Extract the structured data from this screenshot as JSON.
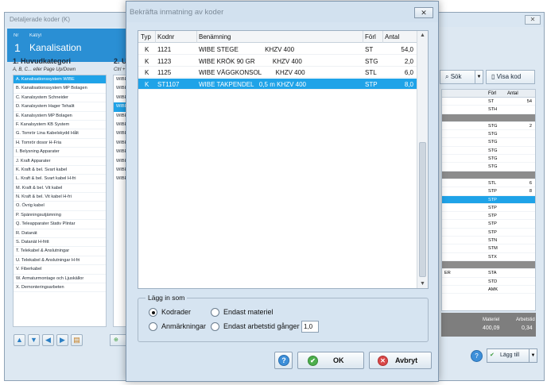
{
  "bg": {
    "title": "Detaljerade koder (K)",
    "close": "✕",
    "header": {
      "nr_label": "Nr",
      "kat_label": "Kat/yl",
      "number": "1",
      "name": "Kanalisation"
    },
    "huvudkategori": {
      "title": "1. Huvudkategori",
      "hint": "A, B, C... eller Page Up/Down",
      "items": [
        "A. Kanalisationssystem WIBE",
        "B. Kanalisationssystem MP Bolagen",
        "C. Kanalsystem Schneider",
        "D. Kanalsystem Hager Tehalit",
        "E. Kanalsystem MP Bolagen",
        "F. Kanalsystem KB System",
        "G. Tomrör Lina Kabelskydd Hålt",
        "H. Tomrör dosor H-Fria",
        "I. Belysning Apparater",
        "J. Kraft Apparater",
        "K. Kraft & bel. Svart kabel",
        "L. Kraft & bel. Svart kabel H-fri",
        "M. Kraft & bel. Vit kabel",
        "N. Kraft & bel. Vit kabel H-fri",
        "O. Övrig kabel",
        "P. Spänningsutjämning",
        "Q. Teleapparater Stativ Plintar",
        "R. Datanät",
        "S. Datanät H-fritt",
        "T. Telekabel & Anslutningar",
        "U. Telekabel & Anslutningar H-fri",
        "V. Fiberkabel",
        "W. Armaturmontage och Ljuskällor",
        "X. Demonteringsarbeten"
      ]
    },
    "underkategori": {
      "title": "2. Ur",
      "hint": "Ctrl + U",
      "items": [
        "WIBE",
        "WIBE",
        "WIBE",
        "WIBE",
        "WIBE",
        "WIBE",
        "WIBE",
        "WIBE",
        "WIBE",
        "WIBE",
        "WIBE",
        "WIBE"
      ]
    },
    "sok_label": "Sök",
    "visa_kod_label": "Visa kod",
    "right_grid": {
      "headers": [
        "Förl",
        "Antal"
      ],
      "rows": [
        {
          "a": "",
          "f": "ST",
          "n": "54"
        },
        {
          "a": "",
          "f": "STH",
          "n": ""
        },
        {
          "a": "",
          "f": "",
          "n": "",
          "grp": true
        },
        {
          "a": "",
          "f": "STG",
          "n": "2"
        },
        {
          "a": "",
          "f": "STG",
          "n": ""
        },
        {
          "a": "",
          "f": "STG",
          "n": ""
        },
        {
          "a": "",
          "f": "STG",
          "n": ""
        },
        {
          "a": "",
          "f": "STG",
          "n": ""
        },
        {
          "a": "",
          "f": "STG",
          "n": ""
        },
        {
          "a": "",
          "f": "",
          "n": "",
          "grp": true
        },
        {
          "a": "",
          "f": "STL",
          "n": "6"
        },
        {
          "a": "",
          "f": "STP",
          "n": "8"
        },
        {
          "a": "",
          "f": "STP",
          "n": "",
          "sel": true
        },
        {
          "a": "",
          "f": "STP",
          "n": ""
        },
        {
          "a": "",
          "f": "STP",
          "n": ""
        },
        {
          "a": "",
          "f": "STP",
          "n": ""
        },
        {
          "a": "",
          "f": "STP",
          "n": ""
        },
        {
          "a": "",
          "f": "STN",
          "n": ""
        },
        {
          "a": "",
          "f": "STM",
          "n": ""
        },
        {
          "a": "",
          "f": "STX",
          "n": ""
        },
        {
          "a": "",
          "f": "",
          "n": "",
          "grp": true
        },
        {
          "a": "ER",
          "f": "STA",
          "n": ""
        },
        {
          "a": "",
          "f": "STD",
          "n": ""
        },
        {
          "a": "",
          "f": "AMK",
          "n": ""
        }
      ]
    },
    "totals": {
      "materiel_label": "Materiel",
      "arbetstid_label": "Arbetstid",
      "materiel_value": "400,09",
      "arbetstid_value": "0,34"
    },
    "lagg_till_label": "Lägg till"
  },
  "dialog": {
    "title": "Bekräfta inmatning av koder",
    "close": "✕",
    "columns": {
      "typ": "Typ",
      "kodnr": "Kodnr",
      "benamning": "Benämning",
      "forl": "Förl",
      "antal": "Antal"
    },
    "rows": [
      {
        "typ": "K",
        "kodnr": "1121",
        "benamning": "WIBE STEGE               KHZV 400",
        "forl": "ST",
        "antal": "54,0",
        "selected": false
      },
      {
        "typ": "K",
        "kodnr": "1123",
        "benamning": "WIBE KRÖK 90 GR          KHZV 400",
        "forl": "STG",
        "antal": "2,0",
        "selected": false
      },
      {
        "typ": "K",
        "kodnr": "1125",
        "benamning": "WIBE VÄGGKONSOL        KHZV 400",
        "forl": "STL",
        "antal": "6,0",
        "selected": false
      },
      {
        "typ": "K",
        "kodnr": "ST1107",
        "benamning": "WIBE TAKPENDEL   0,5 m KHZV 400",
        "forl": "STP",
        "antal": "8,0",
        "selected": true
      }
    ],
    "lagg_in_som": {
      "legend": "Lägg in som",
      "options": {
        "kodrader": "Kodrader",
        "endast_materiel": "Endast materiel",
        "anmarkningar": "Anmärkningar",
        "endast_arbetstid": "Endast arbetstid gånger"
      },
      "selected": "kodrader",
      "multiplier": "1,0"
    },
    "ok_label": "OK",
    "avbryt_label": "Avbryt",
    "help_label": "?"
  }
}
